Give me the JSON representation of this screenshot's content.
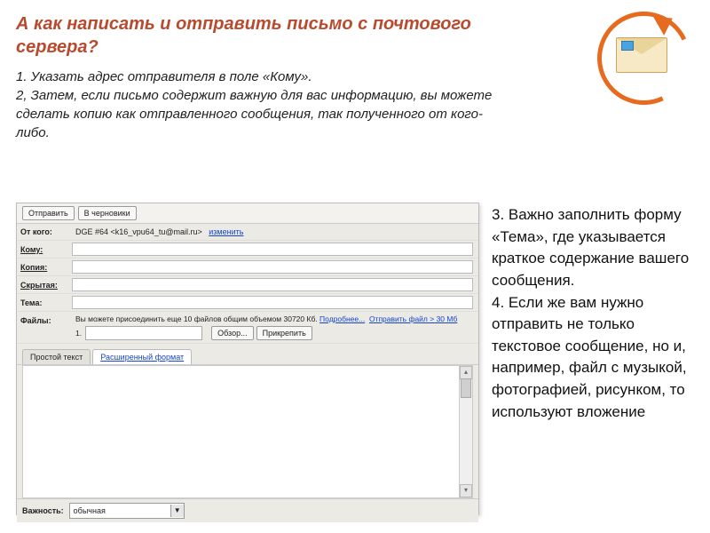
{
  "title_line1": "А как  написать и отправить письмо с почтового",
  "title_line2": "сервера?",
  "intro_1": "1. Указать адрес отправителя в поле «Кому».",
  "intro_2": "2, Затем, если письмо содержит важную для вас информацию, вы можете сделать копию как отправленного сообщения, так полученного от кого-либо.",
  "side_3": "3. Важно заполнить форму «Тема», где указывается краткое содержание  вашего сообщения.",
  "side_4": "4. Если же вам нужно отправить не только текстовое сообщение, но и, например, файл с музыкой, фотографией, рисунком, то используют вложение",
  "compose": {
    "send": "Отправить",
    "drafts": "В черновики",
    "from_label": "От кого:",
    "from_value": "DGE #64 <k16_vpu64_tu@mail.ru>",
    "change": "изменить",
    "to_label": "Кому:",
    "cc_label": "Копия:",
    "bcc_label": "Скрытая:",
    "subject_label": "Тема:",
    "files_label": "Файлы:",
    "files_info": "Вы можете присоединить еще 10 файлов общим объемом 30720 Кб.",
    "files_more": "Подробнее...",
    "files_big": "Отправить файл > 30 Мб",
    "file_num": "1.",
    "browse": "Обзор...",
    "attach": "Прикрепить",
    "tab_plain": "Простой текст",
    "tab_rich": "Расширенный формат",
    "importance_label": "Важность:",
    "importance_value": "обычная"
  }
}
